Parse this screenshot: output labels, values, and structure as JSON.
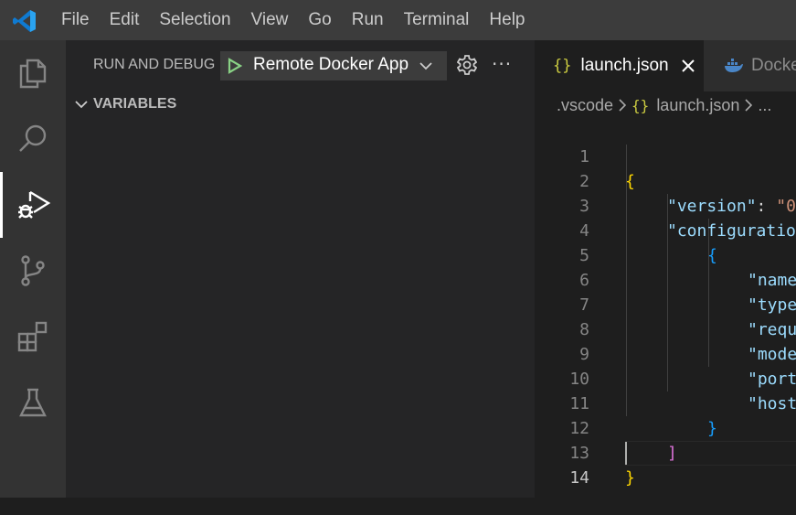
{
  "menu": [
    "File",
    "Edit",
    "Selection",
    "View",
    "Go",
    "Run",
    "Terminal",
    "Help"
  ],
  "activity_bar": {
    "items": [
      {
        "icon": "explorer-icon",
        "active": false
      },
      {
        "icon": "search-icon",
        "active": false
      },
      {
        "icon": "run-debug-icon",
        "active": true
      },
      {
        "icon": "source-control-icon",
        "active": false
      },
      {
        "icon": "extensions-icon",
        "active": false
      },
      {
        "icon": "testing-icon",
        "active": false
      }
    ]
  },
  "sidebar": {
    "title": "RUN AND DEBUG",
    "config": "Remote Docker App",
    "more": "···",
    "variables_label": "VARIABLES"
  },
  "tabs": [
    {
      "label": "launch.json",
      "icon": "json-braces-icon",
      "active": true
    },
    {
      "label": "Docke",
      "icon": "docker-icon",
      "active": false
    }
  ],
  "breadcrumb": {
    "folder": ".vscode",
    "file": "launch.json",
    "more": "..."
  },
  "colors": {
    "accent": "#007acc",
    "run_green": "#89d185",
    "bracket_yellow": "#ffd700",
    "bracket_blue": "#179fff",
    "bracket_pink": "#da70d6",
    "json_key": "#9cdcfe",
    "json_string": "#ce9178"
  },
  "code": {
    "line_numbers": [
      "1",
      "2",
      "3",
      "4",
      "5",
      "6",
      "7",
      "8",
      "9",
      "10",
      "11",
      "12",
      "13",
      "14"
    ],
    "l1": "{",
    "l2_key": "\"version\"",
    "l2_colon": ": ",
    "l2_val": "\"0",
    "l3_key": "\"configuratio",
    "l4": "{",
    "l5": "\"name",
    "l6": "\"type",
    "l7": "\"requ",
    "l8": "\"mode",
    "l9": "\"port",
    "l10": "\"host",
    "l11": "}",
    "l12": "]",
    "l13": "}"
  }
}
